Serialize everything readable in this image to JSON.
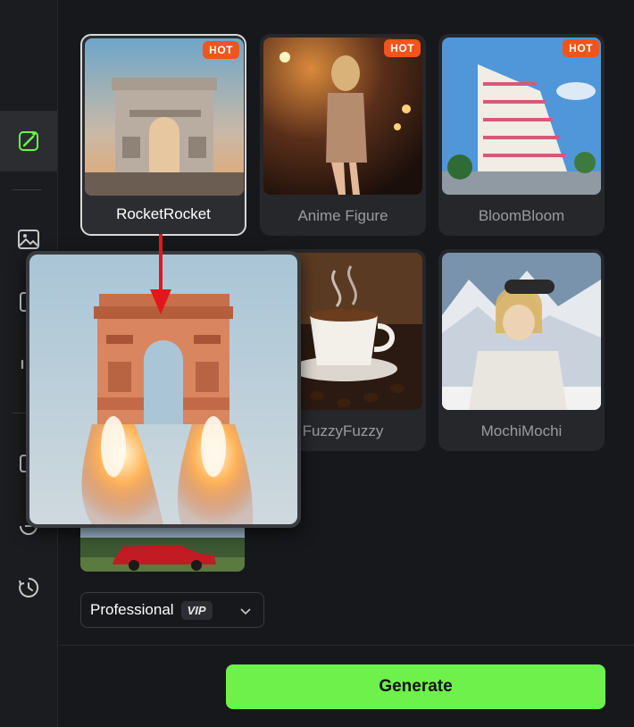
{
  "sidebar": {
    "icons": [
      "magic-wand-icon",
      "image-icon",
      "template-icon",
      "audio-bars-icon",
      "copy-icon",
      "refresh-icon",
      "history-icon"
    ],
    "accent": "#6ff14c"
  },
  "styles": [
    {
      "label": "RocketRocket",
      "hot": "HOT",
      "selected": true
    },
    {
      "label": "Anime Figure",
      "hot": "HOT"
    },
    {
      "label": "BloomBloom",
      "hot": "HOT"
    },
    {
      "label": "FuzzyFuzzy"
    },
    {
      "label": "MochiMochi"
    }
  ],
  "quality": {
    "label": "Professional",
    "badge": "VIP"
  },
  "generate_label": "Generate",
  "colors": {
    "generate": "#6ff14c",
    "hot": "#f2541b",
    "arrow": "#e3171b"
  }
}
